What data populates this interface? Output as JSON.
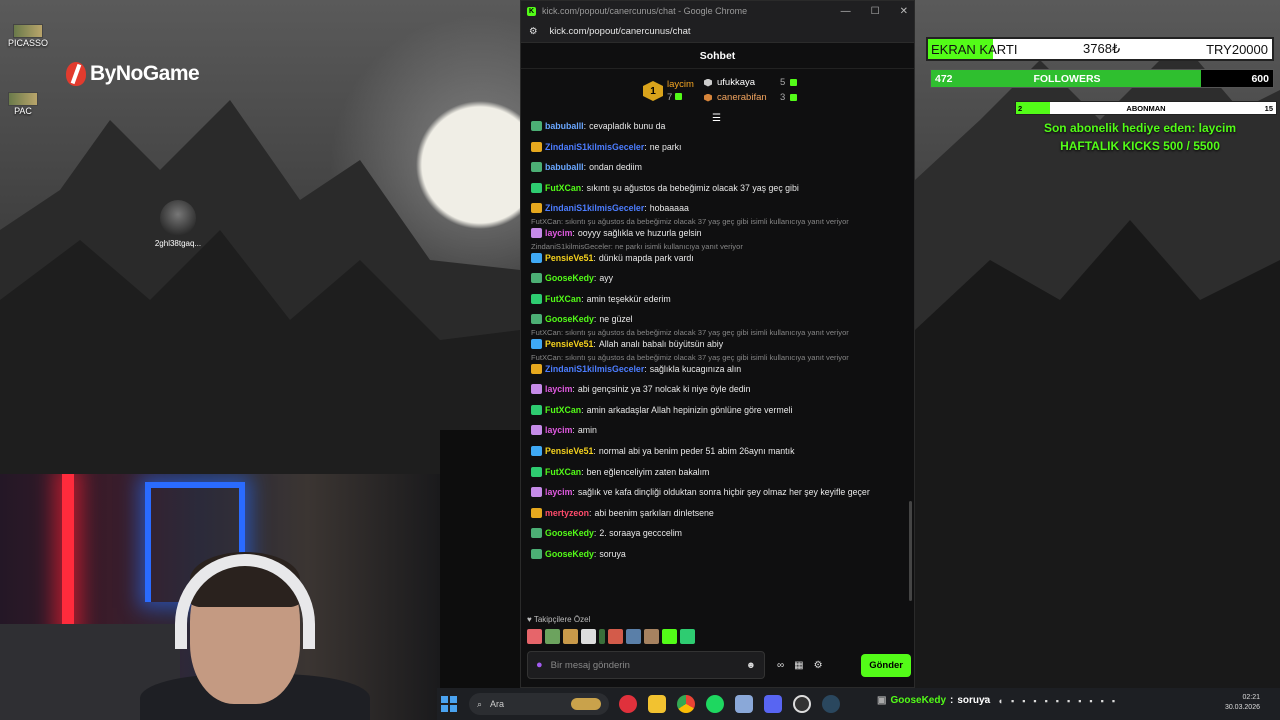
{
  "desktop": {
    "icons": [
      {
        "label": "PICASSO"
      },
      {
        "label": "PAC"
      }
    ],
    "logo_text": "ByNoGame",
    "file_label": "2ghl38tgaq..."
  },
  "browser": {
    "title": "kick.com/popout/canercunus/chat - Google Chrome",
    "url": "kick.com/popout/canercunus/chat",
    "controls": {
      "minimize": "—",
      "maximize": "☐",
      "close": "✕"
    }
  },
  "chat": {
    "header": "Sohbet",
    "leaderboard": {
      "first": {
        "rank": "1",
        "name": "laycim",
        "count": "7"
      },
      "others": [
        {
          "name": "ufukkaya",
          "count": "5"
        },
        {
          "name": "canerabifan",
          "count": "3"
        }
      ]
    },
    "messages": [
      {
        "user": "babuballl",
        "user_color": "#6aa7ff",
        "icon_color": "#4caf75",
        "text": "cevapladık bunu da"
      },
      {
        "user": "ZindaniS1kilmisGeceler",
        "user_color": "#4c7dff",
        "icon_color": "#e6a81e",
        "text": "ne parkı"
      },
      {
        "user": "babuballl",
        "user_color": "#6aa7ff",
        "icon_color": "#4caf75",
        "text": "ondan dediim"
      },
      {
        "user": "FutXCan",
        "user_color": "#53fc18",
        "icon_color": "#2ecc71",
        "text": "sıkıntı şu ağustos da bebeğimiz olacak 37 yaş geç gibi"
      },
      {
        "user": "ZindaniS1kilmisGeceler",
        "user_color": "#4c7dff",
        "icon_color": "#e6a81e",
        "text": "hobaaaaa"
      },
      {
        "reply": "FutXCan: sıkıntı şu ağustos da bebeğimiz olacak 37 yaş geç gibi isimli kullanıcıya yanıt veriyor",
        "user": "laycim",
        "user_color": "#e05ae0",
        "icon_color": "#c58be8",
        "text": "ooyyy sağlıkla ve huzurla gelsin"
      },
      {
        "reply": "ZindaniS1kilmisGeceler: ne parkı isimli kullanıcıya yanıt veriyor",
        "user": "PensieVe51",
        "user_color": "#f5d21e",
        "icon_color": "#3fa9f5",
        "text": "dünkü mapda park vardı"
      },
      {
        "user": "GooseKedy",
        "user_color": "#53fc18",
        "icon_color": "#4caf75",
        "text": "ayy"
      },
      {
        "user": "FutXCan",
        "user_color": "#53fc18",
        "icon_color": "#2ecc71",
        "text": "amin teşekkür ederim"
      },
      {
        "user": "GooseKedy",
        "user_color": "#53fc18",
        "icon_color": "#4caf75",
        "text": "ne güzel"
      },
      {
        "reply": "FutXCan: sıkıntı şu ağustos da bebeğimiz olacak 37 yaş geç gibi isimli kullanıcıya yanıt veriyor",
        "user": "PensieVe51",
        "user_color": "#f5d21e",
        "icon_color": "#3fa9f5",
        "text": "Allah analı babalı büyütsün abiy"
      },
      {
        "reply": "FutXCan: sıkıntı şu ağustos da bebeğimiz olacak 37 yaş geç gibi isimli kullanıcıya yanıt veriyor",
        "user": "ZindaniS1kilmisGeceler",
        "user_color": "#4c7dff",
        "icon_color": "#e6a81e",
        "text": "sağlıkla kucagınıza alın"
      },
      {
        "user": "laycim",
        "user_color": "#e05ae0",
        "icon_color": "#c58be8",
        "text": "abi gençsiniz ya 37 nolcak ki niye öyle dedin"
      },
      {
        "user": "FutXCan",
        "user_color": "#53fc18",
        "icon_color": "#2ecc71",
        "text": "amin arkadaşlar Allah hepinizin gönlüne göre vermeli"
      },
      {
        "user": "laycim",
        "user_color": "#e05ae0",
        "icon_color": "#c58be8",
        "text": "amin"
      },
      {
        "user": "PensieVe51",
        "user_color": "#f5d21e",
        "icon_color": "#3fa9f5",
        "text": "normal abi ya benim peder 51 abim 26aynı mantık"
      },
      {
        "user": "FutXCan",
        "user_color": "#53fc18",
        "icon_color": "#2ecc71",
        "text": "ben eğlenceliyim zaten bakalım"
      },
      {
        "user": "laycim",
        "user_color": "#e05ae0",
        "icon_color": "#c58be8",
        "text": "sağlık ve kafa dinçliği olduktan sonra hiçbir şey olmaz her şey keyifle geçer"
      },
      {
        "user": "mertyzeon",
        "user_color": "#ff4b6b",
        "icon_color": "#e6a81e",
        "text": "abi beenim şarkıları dinletsene"
      },
      {
        "user": "GooseKedy",
        "user_color": "#53fc18",
        "icon_color": "#4caf75",
        "text": "2. soraaya gecccelim"
      },
      {
        "user": "GooseKedy",
        "user_color": "#53fc18",
        "icon_color": "#4caf75",
        "text": "soruya"
      }
    ],
    "followers_only_label": "Takipçilere Özel",
    "input_placeholder": "Bir mesaj gönderin",
    "send_label": "Gönder"
  },
  "overlays": {
    "ekran_karti": {
      "label": "EKRAN KARTI",
      "value": "3768₺",
      "goal": "TRY20000",
      "progress": 0.19
    },
    "followers": {
      "current": "472",
      "label": "FOLLOWERS",
      "goal": "600",
      "progress": 0.79
    },
    "abonman": {
      "current": "2",
      "label": "ABONMAN",
      "goal": "15",
      "progress": 0.13
    },
    "last_gift": "Son abonelik hediye eden: laycim",
    "weekly_kicks": "HAFTALIK KICKS 500 / 5500"
  },
  "taskbar": {
    "search_placeholder": "Ara",
    "alert_user": "GooseKedy",
    "alert_sep": ":",
    "alert_text": "soruya",
    "time": "02:21",
    "date": "30.03.2026"
  },
  "colors": {
    "kick_green": "#53fc18",
    "panel_bg": "#0f0f10"
  }
}
